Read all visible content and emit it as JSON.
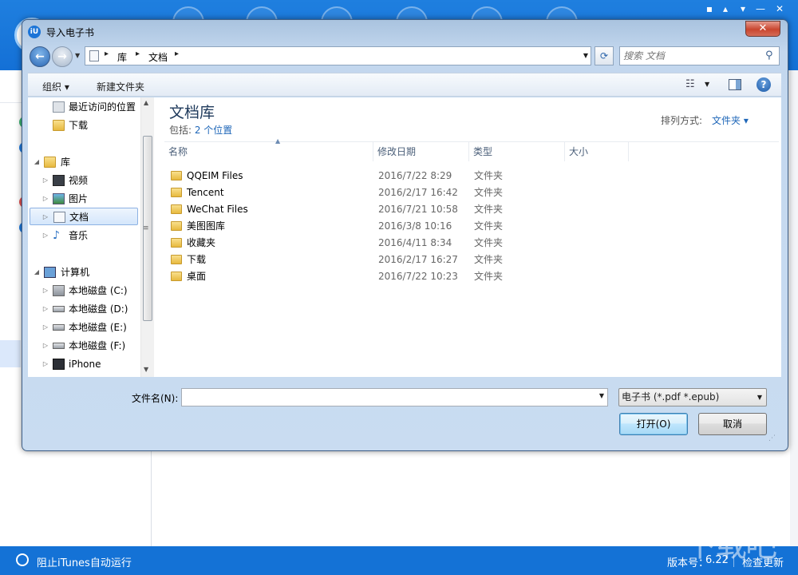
{
  "app": {
    "status": {
      "itunes_option": "阻止iTunes自动运行",
      "version_label": "版本号：",
      "version_value": "6.22",
      "check_update": "检查更新"
    },
    "watermark": "下载吧"
  },
  "dialog": {
    "title": "导入电子书",
    "close_glyph": "✕",
    "address": {
      "crumbs": [
        "库",
        "文档"
      ],
      "search_placeholder": "搜索 文档"
    },
    "toolbar": {
      "organize": "组织 ▾",
      "new_folder": "新建文件夹"
    },
    "nav": {
      "favorites": [
        {
          "label": "最近访问的位置",
          "icon": "recent-places-icon"
        },
        {
          "label": "下载",
          "icon": "downloads-icon"
        }
      ],
      "libraries_label": "库",
      "libraries": [
        {
          "label": "视频",
          "icon": "videos-icon"
        },
        {
          "label": "图片",
          "icon": "pictures-icon"
        },
        {
          "label": "文档",
          "icon": "documents-icon",
          "selected": true
        },
        {
          "label": "音乐",
          "icon": "music-icon"
        }
      ],
      "computer_label": "计算机",
      "drives": [
        {
          "label": "本地磁盘 (C:)",
          "icon": "system-drive-icon"
        },
        {
          "label": "本地磁盘 (D:)",
          "icon": "drive-icon"
        },
        {
          "label": "本地磁盘 (E:)",
          "icon": "drive-icon"
        },
        {
          "label": "本地磁盘 (F:)",
          "icon": "drive-icon"
        },
        {
          "label": "iPhone",
          "icon": "iphone-icon"
        }
      ]
    },
    "content": {
      "library_title": "文档库",
      "includes_label": "包括: ",
      "includes_link": "2 个位置",
      "sort_label": "排列方式:",
      "sort_value": "文件夹 ▾",
      "columns": [
        "名称",
        "修改日期",
        "类型",
        "大小"
      ],
      "files": [
        {
          "name": "QQEIM Files",
          "date": "2016/7/22 8:29",
          "type": "文件夹",
          "icon": "folder-icon"
        },
        {
          "name": "Tencent",
          "date": "2016/2/17 16:42",
          "type": "文件夹",
          "icon": "folder-icon"
        },
        {
          "name": "WeChat Files",
          "date": "2016/7/21 10:58",
          "type": "文件夹",
          "icon": "folder-icon"
        },
        {
          "name": "美图图库",
          "date": "2016/3/8 10:16",
          "type": "文件夹",
          "icon": "folder-icon"
        },
        {
          "name": "收藏夹",
          "date": "2016/4/11 8:34",
          "type": "文件夹",
          "icon": "favorites-folder-icon"
        },
        {
          "name": "下载",
          "date": "2016/2/17 16:27",
          "type": "文件夹",
          "icon": "downloads-folder-icon"
        },
        {
          "name": "桌面",
          "date": "2016/7/22 10:23",
          "type": "文件夹",
          "icon": "desktop-folder-icon"
        }
      ]
    },
    "footer": {
      "filename_label": "文件名(N):",
      "filename_value": "",
      "filetype_value": "电子书 (*.pdf *.epub)",
      "open_button": "打开(O)",
      "cancel_button": "取消"
    }
  }
}
